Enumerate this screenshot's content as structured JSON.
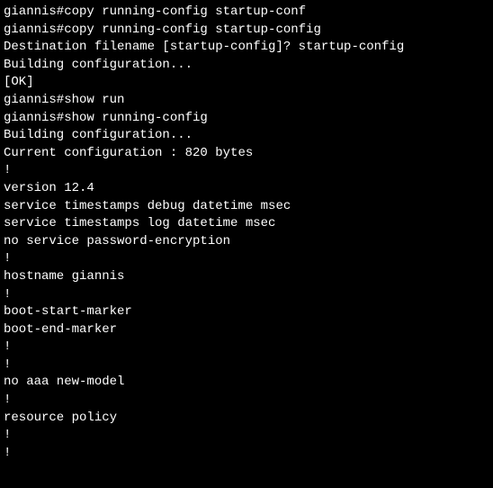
{
  "terminal": {
    "lines": [
      "giannis#copy running-config startup-conf",
      "giannis#copy running-config startup-config",
      "Destination filename [startup-config]? startup-config",
      "Building configuration...",
      "[OK]",
      "giannis#show run",
      "giannis#show running-config",
      "Building configuration...",
      "",
      "Current configuration : 820 bytes",
      "!",
      "version 12.4",
      "service timestamps debug datetime msec",
      "service timestamps log datetime msec",
      "no service password-encryption",
      "!",
      "hostname giannis",
      "!",
      "boot-start-marker",
      "boot-end-marker",
      "!",
      "!",
      "no aaa new-model",
      "!",
      "resource policy",
      "!",
      "!"
    ]
  }
}
